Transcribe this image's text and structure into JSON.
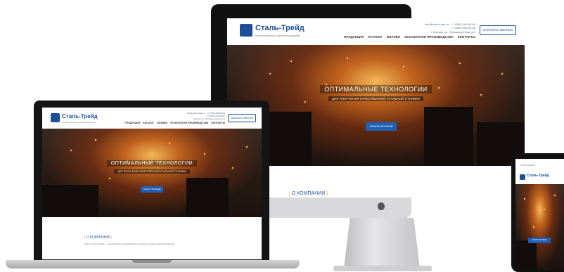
{
  "site": {
    "logo_name": "Сталь-Трейд",
    "logo_tagline": "металлопрокат и металлоизделия",
    "hero_title": "ОПТИМАЛЬНЫЕ ТЕХНОЛОГИИ",
    "hero_subtitle": "ДЛЯ ПОЛУЧЕНИЯ КАЧЕСТВЕННОЙ СТАЛЬНОЙ ОТЛИВКИ",
    "cta_label": "УЗНАТЬ БОЛЬШЕ",
    "callback_label": "ЗАКАЗАТЬ ЗВОНОК",
    "contact_lines": [
      "info@steel-trade.ru · +7 (000) 000-00-00",
      "+7 (000) 000-00-00",
      "г. Москва, ул. Промышленная, д.1"
    ],
    "nav": [
      "ПРОДУКЦИЯ",
      "КАТАЛОГ",
      "БЛАНКИ",
      "ТЕХНОЛОГИИ ПРОИЗВОДСТВА",
      "КОНТАКТЫ"
    ],
    "about_label": "О КОМПАНИИ",
    "about_text": "ООО «Сталь-Трейд» — предприятие по производству стальных отливок и металлоизделий."
  },
  "colors": {
    "brand_blue": "#1d4f9b",
    "cta_blue": "#1f5fb5",
    "accent_orange": "#e3a227"
  }
}
